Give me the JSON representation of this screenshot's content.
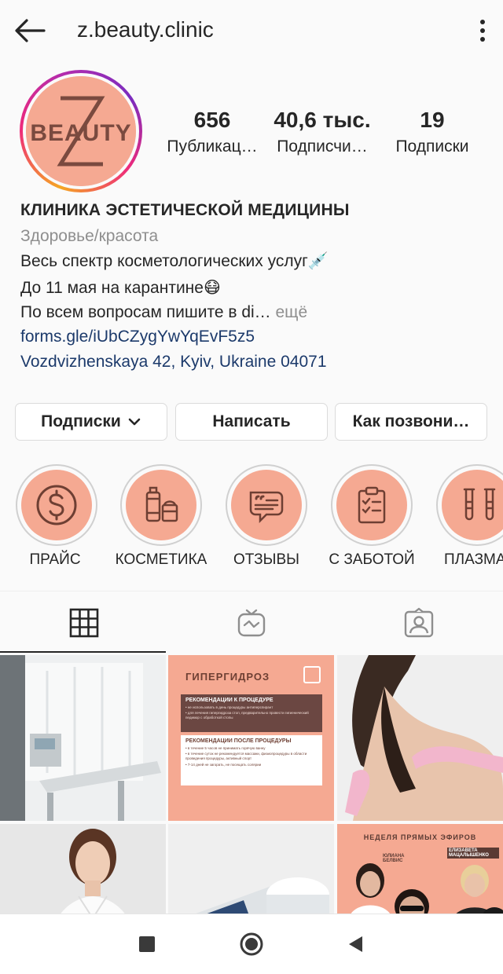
{
  "header": {
    "username": "z.beauty.clinic"
  },
  "profile": {
    "logo_text": "BEAUTY",
    "logo_letter": "Z",
    "stats": [
      {
        "value": "656",
        "label": "Публикац…"
      },
      {
        "value": "40,6 тыс.",
        "label": "Подписчи…"
      },
      {
        "value": "19",
        "label": "Подписки"
      }
    ]
  },
  "bio": {
    "name": "КЛИНИКА ЭСТЕТИЧЕСКОЙ МЕДИЦИНЫ",
    "category": "Здоровье/красота",
    "line1": "Весь спектр косметологических услуг💉",
    "line2": "До 11 мая на карантине😷",
    "line3": "По всем вопросам пишите в di…",
    "more": " ещё",
    "link": "forms.gle/iUbCZygYwYqEvF5z5",
    "address": "Vozdvizhenskaya 42, Kyiv, Ukraine 04071"
  },
  "actions": {
    "following": "Подписки",
    "message": "Написать",
    "call": "Как позвони…"
  },
  "highlights": [
    {
      "label": "ПРАЙС",
      "icon": "dollar-coin-icon"
    },
    {
      "label": "КОСМЕТИКА",
      "icon": "cosmetics-icon"
    },
    {
      "label": "ОТЗЫВЫ",
      "icon": "speech-bubble-icon"
    },
    {
      "label": "С ЗАБОТОЙ",
      "icon": "clipboard-icon"
    },
    {
      "label": "ПЛАЗМА",
      "icon": "test-tubes-icon"
    }
  ],
  "posts": {
    "post2": {
      "title": "ГИПЕРГИДРОЗ",
      "box1_title": "РЕКОМЕНДАЦИИ К ПРОЦЕДУРЕ",
      "box1_items": [
        "• не использовать в день процедуры антиперспирант",
        "• для лечения гипергидроза стоп, предварительно провести гигиенический педикюр с обработкой стопы"
      ],
      "box2_title": "РЕКОМЕНДАЦИИ ПОСЛЕ ПРОЦЕДУРЫ",
      "box2_items": [
        "• в течение 5 часов не принимать горячую ванну",
        "• в течение суток не рекомендуется массажи, физиопроцедуры в области проведения процедуры, активный спорт",
        "• 7-14 дней не загорать, не посещать солярии"
      ]
    },
    "post6": {
      "title": "НЕДЕЛЯ ПРЯМЫХ ЭФИРОВ",
      "name1": "ЮЛИАНА БЕЛВИС",
      "name2": "ЕЛИЗАВЕТА МАЦАЛЫШЕНКО"
    }
  },
  "colors": {
    "peach": "#f5a992",
    "brown": "#7a4a3f",
    "link": "#1c3a6b"
  }
}
